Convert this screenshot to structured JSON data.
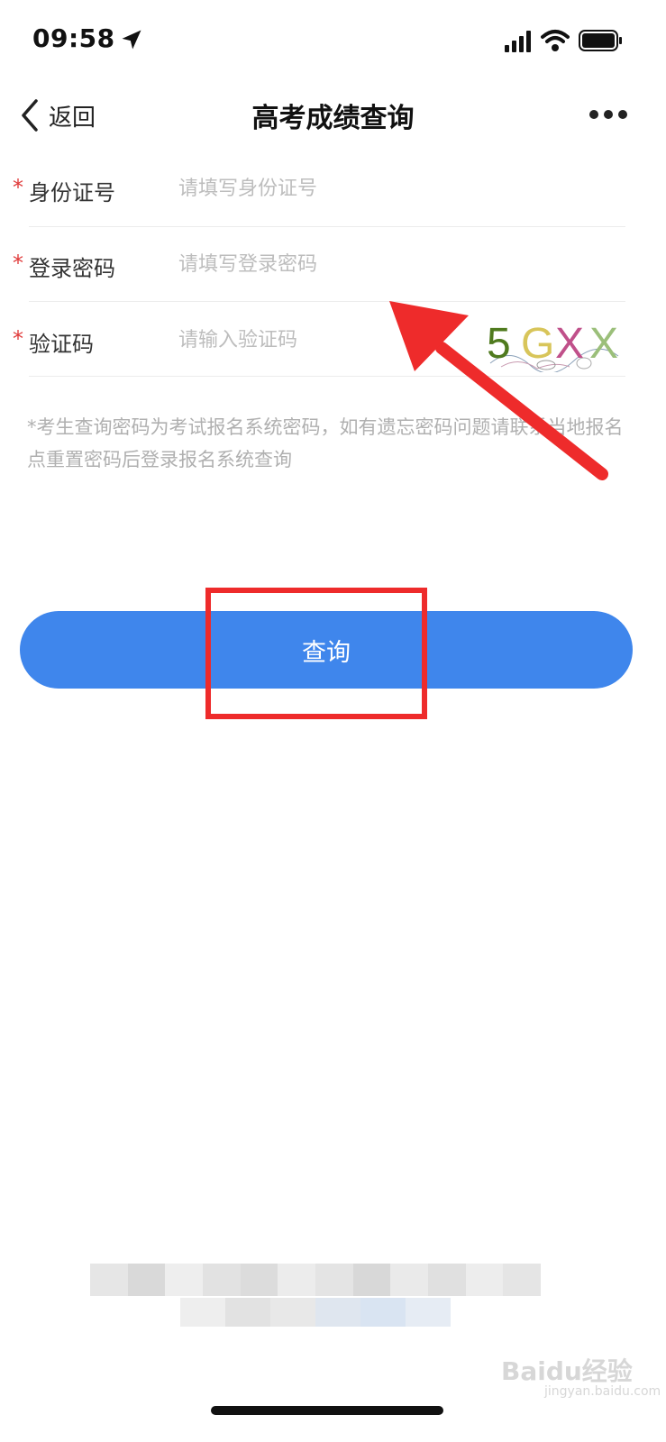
{
  "status_bar": {
    "time": "09:58",
    "icons": [
      "location-arrow-icon",
      "signal-icon",
      "wifi-icon",
      "battery-icon"
    ]
  },
  "nav": {
    "back_label": "返回",
    "title": "高考成绩查询",
    "more_icon": "more-icon"
  },
  "form": {
    "required_mark": "*",
    "fields": [
      {
        "label": "身份证号",
        "placeholder": "请填写身份证号",
        "value": ""
      },
      {
        "label": "登录密码",
        "placeholder": "请填写登录密码",
        "value": ""
      },
      {
        "label": "验证码",
        "placeholder": "请输入验证码",
        "value": ""
      }
    ],
    "captcha": {
      "text": "5GXX",
      "chars": [
        "5",
        "G",
        "X",
        "X"
      ],
      "colors": [
        "#4f7a1e",
        "#d8c55a",
        "#c0508a",
        "#9bbf7a"
      ]
    }
  },
  "hint": "*考生查询密码为考试报名系统密码，如有遗忘密码问题请联系当地报名点重置密码后登录报名系统查询",
  "query_button": {
    "label": "查询",
    "color": "#3f86ec"
  },
  "annotations": {
    "color": "#ee2b2b"
  },
  "watermark": {
    "brand": "Baidu经验",
    "url": "jingyan.baidu.com"
  }
}
